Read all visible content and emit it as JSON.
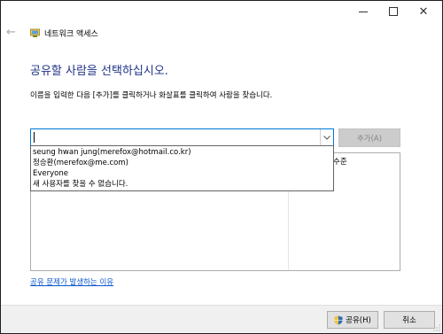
{
  "navigation": {
    "back_glyph": "←",
    "title": "네트워크 액세스"
  },
  "window_controls": {
    "minimize": "minimize",
    "maximize": "maximize",
    "close_glyph": "✕"
  },
  "main": {
    "heading": "공유할 사람을 선택하십시오.",
    "instruction": "이름을 입력한 다음 [추가]를 클릭하거나 화살표를 클릭하여 사람을 찾습니다.",
    "name_input_value": "",
    "add_button_label": "추가(A)",
    "permission_column_header": "수준",
    "help_link": "공유 문제가 발생하는 이유"
  },
  "dropdown": {
    "options": [
      "seung hwan jung(merefox@hotmail.co.kr)",
      "정승환(merefox@me.com)",
      "Everyone",
      "새 사용자를 찾을 수 없습니다."
    ]
  },
  "footer": {
    "share_button_label": "공유(H)",
    "cancel_button_label": "취소"
  },
  "colors": {
    "heading": "#1e3287",
    "link": "#0b57d0",
    "disabled_button_bg": "#cccccc",
    "footer_bg": "#f0f0f0"
  },
  "icons": {
    "back": "back-arrow-icon",
    "network": "network-icon",
    "dropdown": "chevron-down-icon",
    "shield": "uac-shield-icon"
  }
}
